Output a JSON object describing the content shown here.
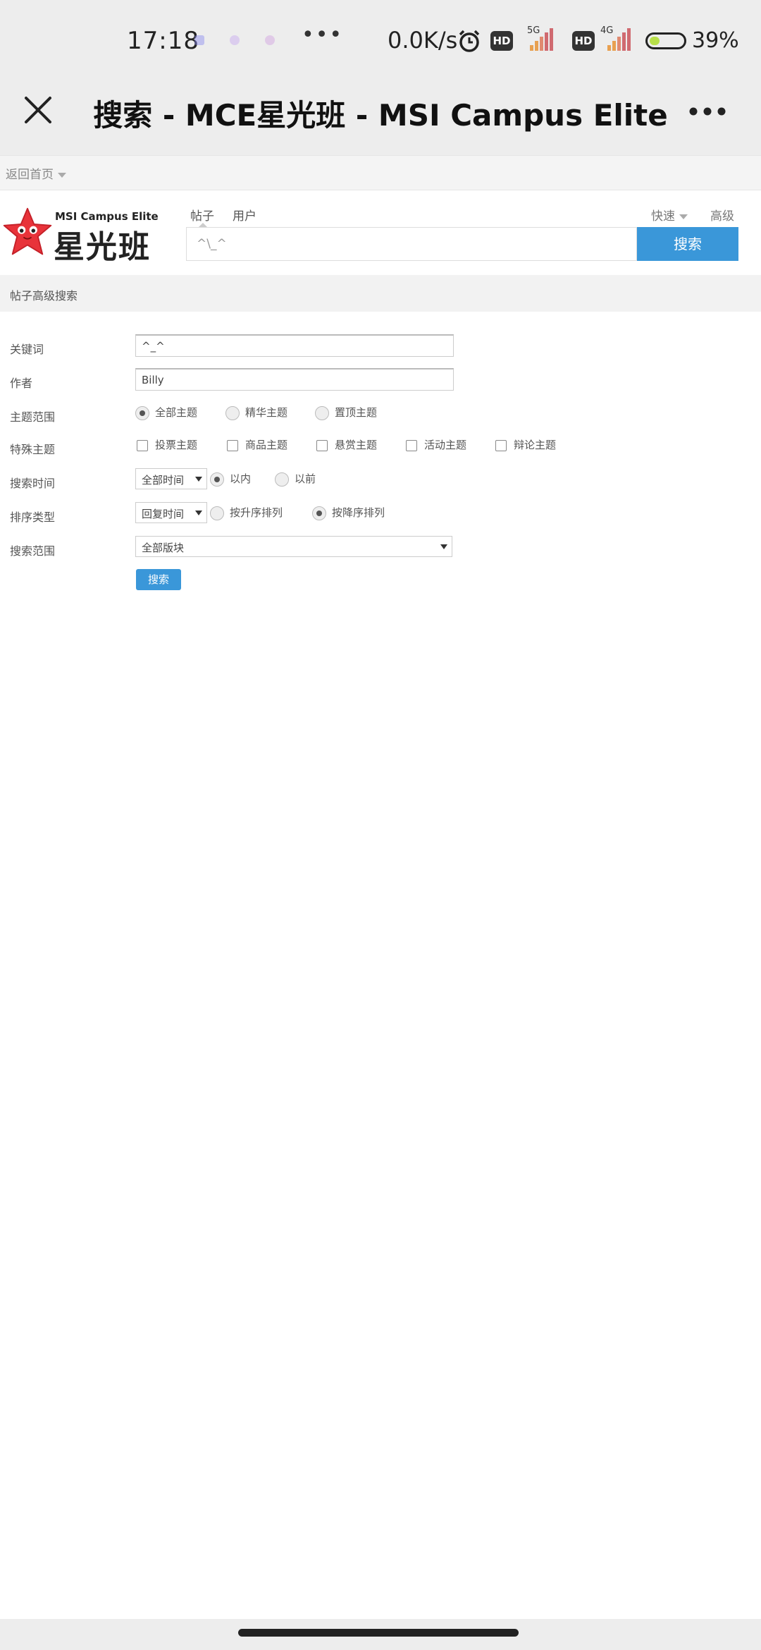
{
  "status_bar": {
    "time": "17:18",
    "dots": "•••",
    "net_speed": "0.0K/s",
    "hd1": "HD",
    "net1": "5G",
    "hd2": "HD",
    "net2": "4G",
    "battery": "39%"
  },
  "title_bar": {
    "title": "搜索 - MCE星光班 - MSI Campus Elite"
  },
  "back_row": {
    "label": "返回首页"
  },
  "header": {
    "logo_en": "MSI Campus Elite",
    "logo_cn": "星光班",
    "tabs": [
      "帖子",
      "用户"
    ],
    "quick": "快速",
    "advanced": "高级",
    "search_value": "^\\_^",
    "search_button": "搜索"
  },
  "section": {
    "title": "帖子高级搜索"
  },
  "form": {
    "keyword": {
      "label": "关键词",
      "value": "^_^"
    },
    "author": {
      "label": "作者",
      "value": "Billy"
    },
    "topic_range": {
      "label": "主题范围",
      "options": [
        "全部主题",
        "精华主题",
        "置顶主题"
      ],
      "selected": 0
    },
    "special_topics": {
      "label": "特殊主题",
      "options": [
        "投票主题",
        "商品主题",
        "悬赏主题",
        "活动主题",
        "辩论主题"
      ]
    },
    "search_time": {
      "label": "搜索时间",
      "select": "全部时间",
      "options": [
        "以内",
        "以前"
      ],
      "selected": 0
    },
    "sort_type": {
      "label": "排序类型",
      "select": "回复时间",
      "options": [
        "按升序排列",
        "按降序排列"
      ],
      "selected": 1
    },
    "search_range": {
      "label": "搜索范围",
      "select": "全部版块"
    },
    "submit": "搜索"
  },
  "colors": {
    "accent": "#3a97d9",
    "bar_bg": "#ededed",
    "logo_star": "#e8333a"
  }
}
